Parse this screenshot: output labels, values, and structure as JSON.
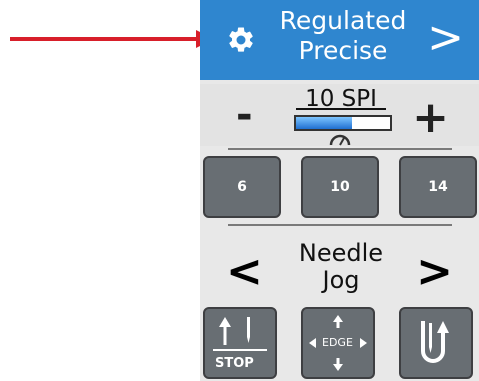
{
  "header": {
    "title_line1": "Regulated",
    "title_line2": "Precise",
    "next_label": ">"
  },
  "spi": {
    "label": "10 SPI",
    "decrease_label": "-",
    "increase_label": "+",
    "level_fraction": 0.6
  },
  "presets": [
    {
      "label": "6"
    },
    {
      "label": "10"
    },
    {
      "label": "14"
    }
  ],
  "jog": {
    "prev_label": "<",
    "title_line1": "Needle",
    "title_line2": "Jog",
    "next_label": ">"
  },
  "bottom_buttons": {
    "stop_label": "STOP",
    "edge_label": "EDGE"
  },
  "colors": {
    "header_bg": "#2f86cf",
    "annotation_arrow": "#d81f2a",
    "button_bg": "#686e73"
  },
  "icons": [
    "gear-icon",
    "gauge-icon",
    "needle-up-icon",
    "edge-arrows-icon",
    "thread-loop-icon"
  ]
}
